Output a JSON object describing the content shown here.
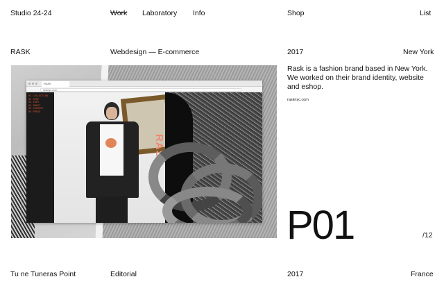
{
  "header": {
    "brand": "Studio 24-24",
    "nav": [
      {
        "label": "Work",
        "struck": true
      },
      {
        "label": "Laboratory",
        "struck": false
      },
      {
        "label": "Info",
        "struck": false
      }
    ],
    "shop": "Shop",
    "list": "List"
  },
  "project": {
    "name": "RASK",
    "category": "Webdesign — E-commerce",
    "year": "2017",
    "location": "New York",
    "description": "Rask is a fashion brand based in New York. We worked on their brand identity, website and eshop.",
    "url": "rasknyc.com",
    "index": "P01",
    "total": "/12",
    "preview": {
      "browser_tab": "RASK",
      "browser_url": "rasknyc.com",
      "site_nav": [
        "01 COLLECTION",
        "02 SHOP",
        "03 INFO",
        "04 ABOUT",
        "05 CONTACT",
        "06 PRESS"
      ],
      "logo_text": "RASK"
    }
  },
  "next_project": {
    "name": "Tu ne Tuneras Point",
    "category": "Editorial",
    "year": "2017",
    "location": "France"
  }
}
